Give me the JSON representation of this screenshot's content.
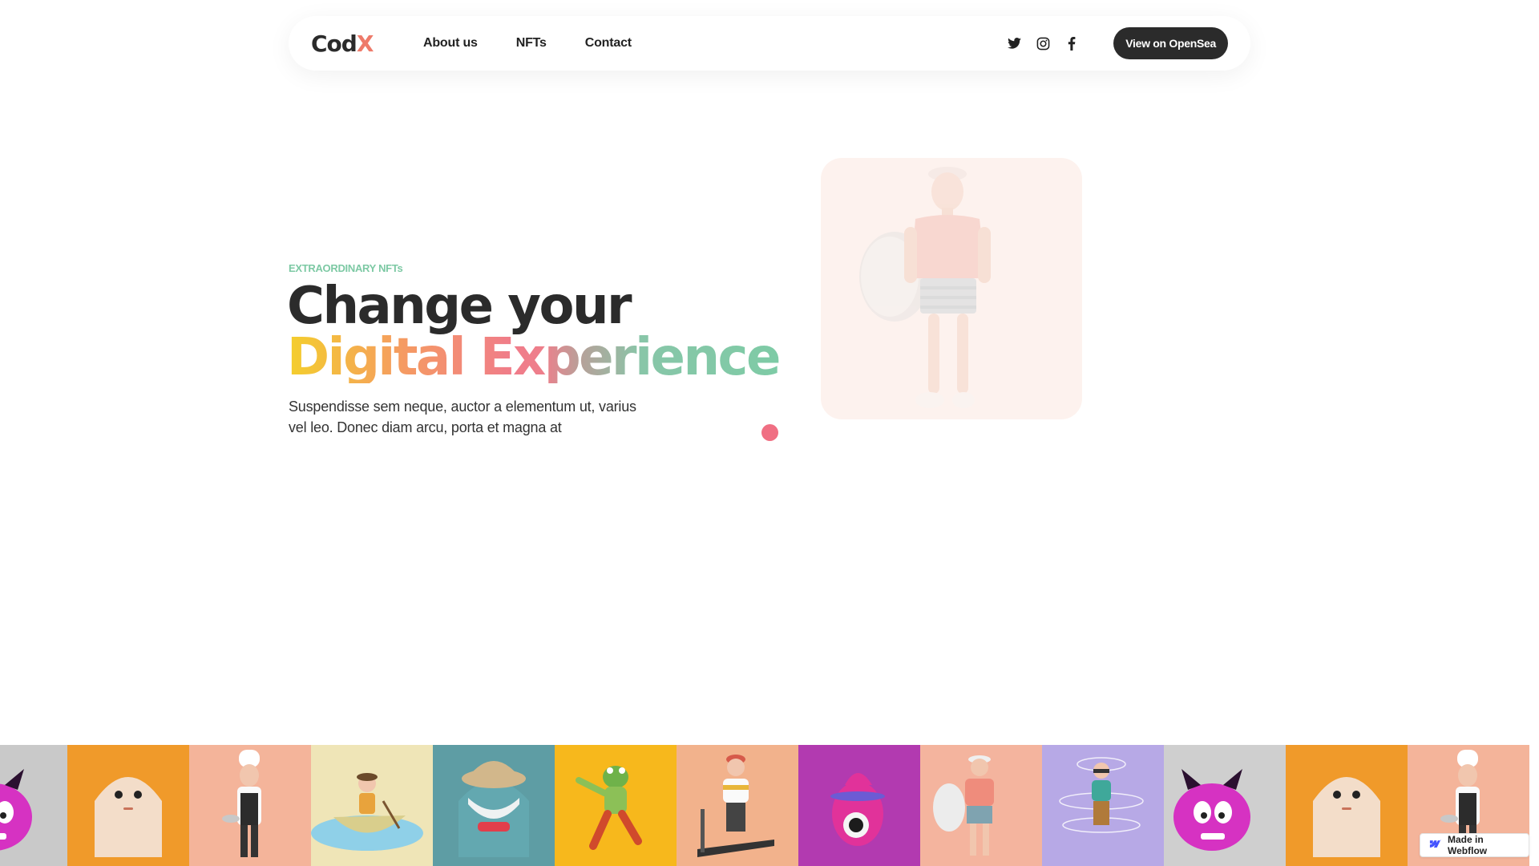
{
  "nav": {
    "logo_main": "Cod",
    "logo_accent": "X",
    "links": [
      "About us",
      "NFTs",
      "Contact"
    ],
    "social_icons": [
      "twitter-icon",
      "instagram-icon",
      "facebook-icon"
    ],
    "cta_label": "View on OpenSea"
  },
  "hero": {
    "eyebrow": "EXTRAORDINARY NFTs",
    "headline_line1": "Change your",
    "headline_line2": "Digital Experience",
    "body": "Suspendisse sem neque, auctor a elementum ut, varius vel leo. Donec diam arcu, porta et magna at",
    "card_image": "surfer-character"
  },
  "strip": {
    "tiles": [
      {
        "character": "pink-devil",
        "bg": "#c9c9c9"
      },
      {
        "character": "ghost",
        "bg": "#f09a2a"
      },
      {
        "character": "chef",
        "bg": "#f4b49a"
      },
      {
        "character": "rowboat-boy",
        "bg": "#efe5b7"
      },
      {
        "character": "teal-monster",
        "bg": "#5e9da4"
      },
      {
        "character": "green-frog-runner",
        "bg": "#f7b81c"
      },
      {
        "character": "treadmill-runner",
        "bg": "#f2b28c"
      },
      {
        "character": "magenta-cyclops",
        "bg": "#b23ab0"
      },
      {
        "character": "surfer",
        "bg": "#f4b49e"
      },
      {
        "character": "vr-player",
        "bg": "#b7a9e6"
      },
      {
        "character": "pink-devil",
        "bg": "#cfcfcf"
      },
      {
        "character": "ghost",
        "bg": "#f09a2a"
      },
      {
        "character": "chef",
        "bg": "#f4b49a"
      }
    ]
  },
  "badge": {
    "label": "Made in Webflow"
  },
  "colors": {
    "accent_green": "#7dc9a4",
    "accent_pink": "#f06f83",
    "dark": "#2b2b2b"
  }
}
